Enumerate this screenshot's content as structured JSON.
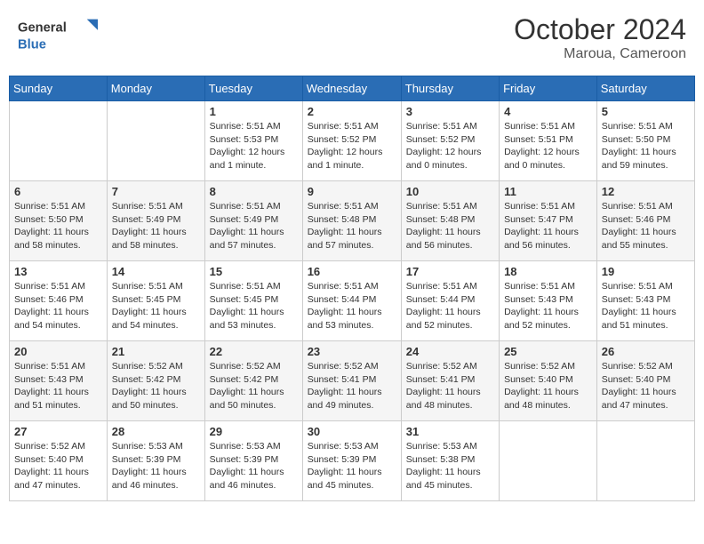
{
  "header": {
    "logo_general": "General",
    "logo_blue": "Blue",
    "month_title": "October 2024",
    "location": "Maroua, Cameroon"
  },
  "weekdays": [
    "Sunday",
    "Monday",
    "Tuesday",
    "Wednesday",
    "Thursday",
    "Friday",
    "Saturday"
  ],
  "weeks": [
    [
      {
        "day": "",
        "info": ""
      },
      {
        "day": "",
        "info": ""
      },
      {
        "day": "1",
        "info": "Sunrise: 5:51 AM\nSunset: 5:53 PM\nDaylight: 12 hours\nand 1 minute."
      },
      {
        "day": "2",
        "info": "Sunrise: 5:51 AM\nSunset: 5:52 PM\nDaylight: 12 hours\nand 1 minute."
      },
      {
        "day": "3",
        "info": "Sunrise: 5:51 AM\nSunset: 5:52 PM\nDaylight: 12 hours\nand 0 minutes."
      },
      {
        "day": "4",
        "info": "Sunrise: 5:51 AM\nSunset: 5:51 PM\nDaylight: 12 hours\nand 0 minutes."
      },
      {
        "day": "5",
        "info": "Sunrise: 5:51 AM\nSunset: 5:50 PM\nDaylight: 11 hours\nand 59 minutes."
      }
    ],
    [
      {
        "day": "6",
        "info": "Sunrise: 5:51 AM\nSunset: 5:50 PM\nDaylight: 11 hours\nand 58 minutes."
      },
      {
        "day": "7",
        "info": "Sunrise: 5:51 AM\nSunset: 5:49 PM\nDaylight: 11 hours\nand 58 minutes."
      },
      {
        "day": "8",
        "info": "Sunrise: 5:51 AM\nSunset: 5:49 PM\nDaylight: 11 hours\nand 57 minutes."
      },
      {
        "day": "9",
        "info": "Sunrise: 5:51 AM\nSunset: 5:48 PM\nDaylight: 11 hours\nand 57 minutes."
      },
      {
        "day": "10",
        "info": "Sunrise: 5:51 AM\nSunset: 5:48 PM\nDaylight: 11 hours\nand 56 minutes."
      },
      {
        "day": "11",
        "info": "Sunrise: 5:51 AM\nSunset: 5:47 PM\nDaylight: 11 hours\nand 56 minutes."
      },
      {
        "day": "12",
        "info": "Sunrise: 5:51 AM\nSunset: 5:46 PM\nDaylight: 11 hours\nand 55 minutes."
      }
    ],
    [
      {
        "day": "13",
        "info": "Sunrise: 5:51 AM\nSunset: 5:46 PM\nDaylight: 11 hours\nand 54 minutes."
      },
      {
        "day": "14",
        "info": "Sunrise: 5:51 AM\nSunset: 5:45 PM\nDaylight: 11 hours\nand 54 minutes."
      },
      {
        "day": "15",
        "info": "Sunrise: 5:51 AM\nSunset: 5:45 PM\nDaylight: 11 hours\nand 53 minutes."
      },
      {
        "day": "16",
        "info": "Sunrise: 5:51 AM\nSunset: 5:44 PM\nDaylight: 11 hours\nand 53 minutes."
      },
      {
        "day": "17",
        "info": "Sunrise: 5:51 AM\nSunset: 5:44 PM\nDaylight: 11 hours\nand 52 minutes."
      },
      {
        "day": "18",
        "info": "Sunrise: 5:51 AM\nSunset: 5:43 PM\nDaylight: 11 hours\nand 52 minutes."
      },
      {
        "day": "19",
        "info": "Sunrise: 5:51 AM\nSunset: 5:43 PM\nDaylight: 11 hours\nand 51 minutes."
      }
    ],
    [
      {
        "day": "20",
        "info": "Sunrise: 5:51 AM\nSunset: 5:43 PM\nDaylight: 11 hours\nand 51 minutes."
      },
      {
        "day": "21",
        "info": "Sunrise: 5:52 AM\nSunset: 5:42 PM\nDaylight: 11 hours\nand 50 minutes."
      },
      {
        "day": "22",
        "info": "Sunrise: 5:52 AM\nSunset: 5:42 PM\nDaylight: 11 hours\nand 50 minutes."
      },
      {
        "day": "23",
        "info": "Sunrise: 5:52 AM\nSunset: 5:41 PM\nDaylight: 11 hours\nand 49 minutes."
      },
      {
        "day": "24",
        "info": "Sunrise: 5:52 AM\nSunset: 5:41 PM\nDaylight: 11 hours\nand 48 minutes."
      },
      {
        "day": "25",
        "info": "Sunrise: 5:52 AM\nSunset: 5:40 PM\nDaylight: 11 hours\nand 48 minutes."
      },
      {
        "day": "26",
        "info": "Sunrise: 5:52 AM\nSunset: 5:40 PM\nDaylight: 11 hours\nand 47 minutes."
      }
    ],
    [
      {
        "day": "27",
        "info": "Sunrise: 5:52 AM\nSunset: 5:40 PM\nDaylight: 11 hours\nand 47 minutes."
      },
      {
        "day": "28",
        "info": "Sunrise: 5:53 AM\nSunset: 5:39 PM\nDaylight: 11 hours\nand 46 minutes."
      },
      {
        "day": "29",
        "info": "Sunrise: 5:53 AM\nSunset: 5:39 PM\nDaylight: 11 hours\nand 46 minutes."
      },
      {
        "day": "30",
        "info": "Sunrise: 5:53 AM\nSunset: 5:39 PM\nDaylight: 11 hours\nand 45 minutes."
      },
      {
        "day": "31",
        "info": "Sunrise: 5:53 AM\nSunset: 5:38 PM\nDaylight: 11 hours\nand 45 minutes."
      },
      {
        "day": "",
        "info": ""
      },
      {
        "day": "",
        "info": ""
      }
    ]
  ]
}
